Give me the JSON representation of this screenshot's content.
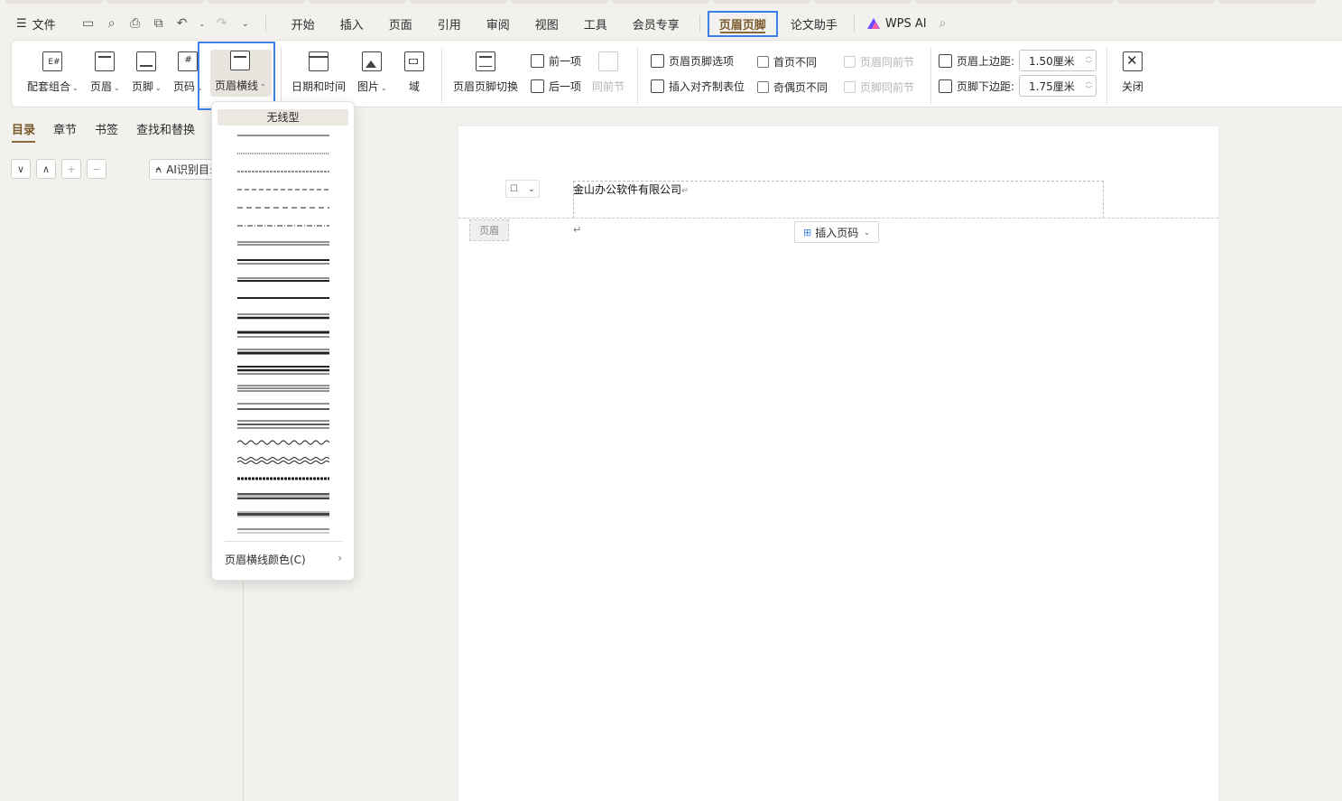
{
  "menu": {
    "file_label": "文件",
    "tabs": [
      "开始",
      "插入",
      "页面",
      "引用",
      "审阅",
      "视图",
      "工具",
      "会员专享"
    ],
    "active_tab": "页眉页脚",
    "after_tab": "论文助手",
    "wps_ai": "WPS AI"
  },
  "ribbon": {
    "combo": "配套组合",
    "header": "页眉",
    "footer": "页脚",
    "page_number": "页码",
    "header_line": "页眉横线",
    "datetime": "日期和时间",
    "picture": "图片",
    "field": "域",
    "switch": "页眉页脚切换",
    "prev": "前一项",
    "next": "后一项",
    "same_prev": "同前节",
    "options": "页眉页脚选项",
    "align_tab": "插入对齐制表位",
    "first_diff": "首页不同",
    "odd_even_diff": "奇偶页不同",
    "header_same_prev": "页眉同前节",
    "footer_same_prev": "页脚同前节",
    "top_margin_label": "页眉上边距:",
    "top_margin_value": "1.50厘米",
    "bottom_margin_label": "页脚下边距:",
    "bottom_margin_value": "1.75厘米",
    "close": "关闭"
  },
  "nav": {
    "tabs": [
      "目录",
      "章节",
      "书签",
      "查找和替换"
    ],
    "ai_button": "AI识别目录"
  },
  "dropdown": {
    "none_label": "无线型",
    "color_label": "页眉横线颜色(C)"
  },
  "document": {
    "header_text": "金山办公软件有限公司",
    "header_label": "页眉",
    "insert_page_number": "插入页码"
  },
  "colors": {
    "accent": "#3f7ee8",
    "brand": "#8b6a3a"
  }
}
